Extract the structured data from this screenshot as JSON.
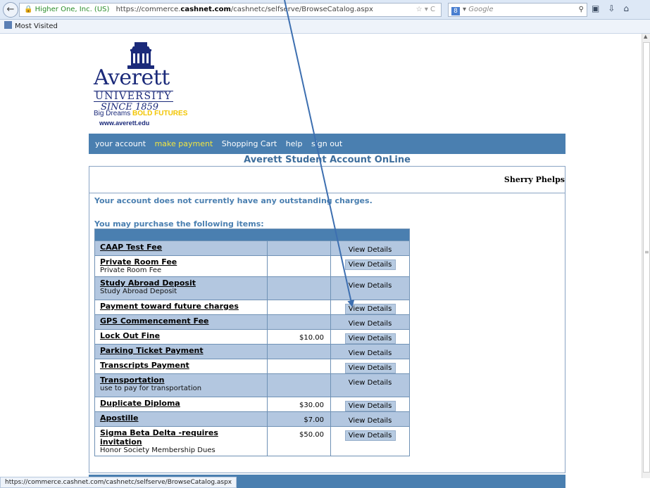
{
  "browser": {
    "identity": "Higher One, Inc. (US)",
    "url_prefix": "https://commerce.",
    "url_host": "cashnet.com",
    "url_path": "/cashnetc/selfserve/BrowseCatalog.aspx",
    "search_placeholder": "Google",
    "search_engine_glyph": "8",
    "bookmarks_label": "Most Visited",
    "status_url": "https://commerce.cashnet.com/cashnetc/selfserve/BrowseCatalog.aspx"
  },
  "logo": {
    "name": "Averett",
    "university": "UNIVERSITY",
    "since": "SINCE 1859",
    "slogan_plain": "Big Dreams",
    "slogan_bold": "BOLD FUTURES",
    "website": "www.averett.edu"
  },
  "nav": {
    "items": [
      "your account",
      "make payment",
      "Shopping Cart",
      "help",
      "sign out"
    ],
    "active": "make payment"
  },
  "page": {
    "title": "Averett Student Account OnLine",
    "user_name": "Sherry Phelps",
    "account_message": "Your account does not currently have any outstanding charges.",
    "purchase_heading": "You may purchase the following items:"
  },
  "items": [
    {
      "name": "CAAP Test Fee",
      "desc": "",
      "price": "",
      "button": "View Details"
    },
    {
      "name": "Private Room Fee",
      "desc": "Private Room Fee",
      "price": "",
      "button": "View Details"
    },
    {
      "name": "Study Abroad Deposit",
      "desc": "Study Abroad Deposit",
      "price": "",
      "button": "View Details"
    },
    {
      "name": "Payment toward future charges",
      "desc": "",
      "price": "",
      "button": "View Details"
    },
    {
      "name": "GPS Commencement Fee",
      "desc": "",
      "price": "",
      "button": "View Details"
    },
    {
      "name": "Lock Out Fine",
      "desc": "",
      "price": "$10.00",
      "button": "View Details"
    },
    {
      "name": "Parking Ticket Payment",
      "desc": "",
      "price": "",
      "button": "View Details"
    },
    {
      "name": "Transcripts Payment",
      "desc": "",
      "price": "",
      "button": "View Details"
    },
    {
      "name": "Transportation",
      "desc": "use to pay for transportation",
      "price": "",
      "button": "View Details"
    },
    {
      "name": "Duplicate Diploma",
      "desc": "",
      "price": "$30.00",
      "button": "View Details"
    },
    {
      "name": "Apostille",
      "desc": "",
      "price": "$7.00",
      "button": "View Details"
    },
    {
      "name": "Sigma Beta Delta -requires invitation",
      "desc": "Honor Society Membership Dues",
      "price": "$50.00",
      "button": "View Details"
    }
  ],
  "colors": {
    "nav_bg": "#4a7fb0",
    "nav_active": "#f2e640",
    "row_alt": "#b3c7e0",
    "annotation_arrow": "#3d6fb0"
  }
}
